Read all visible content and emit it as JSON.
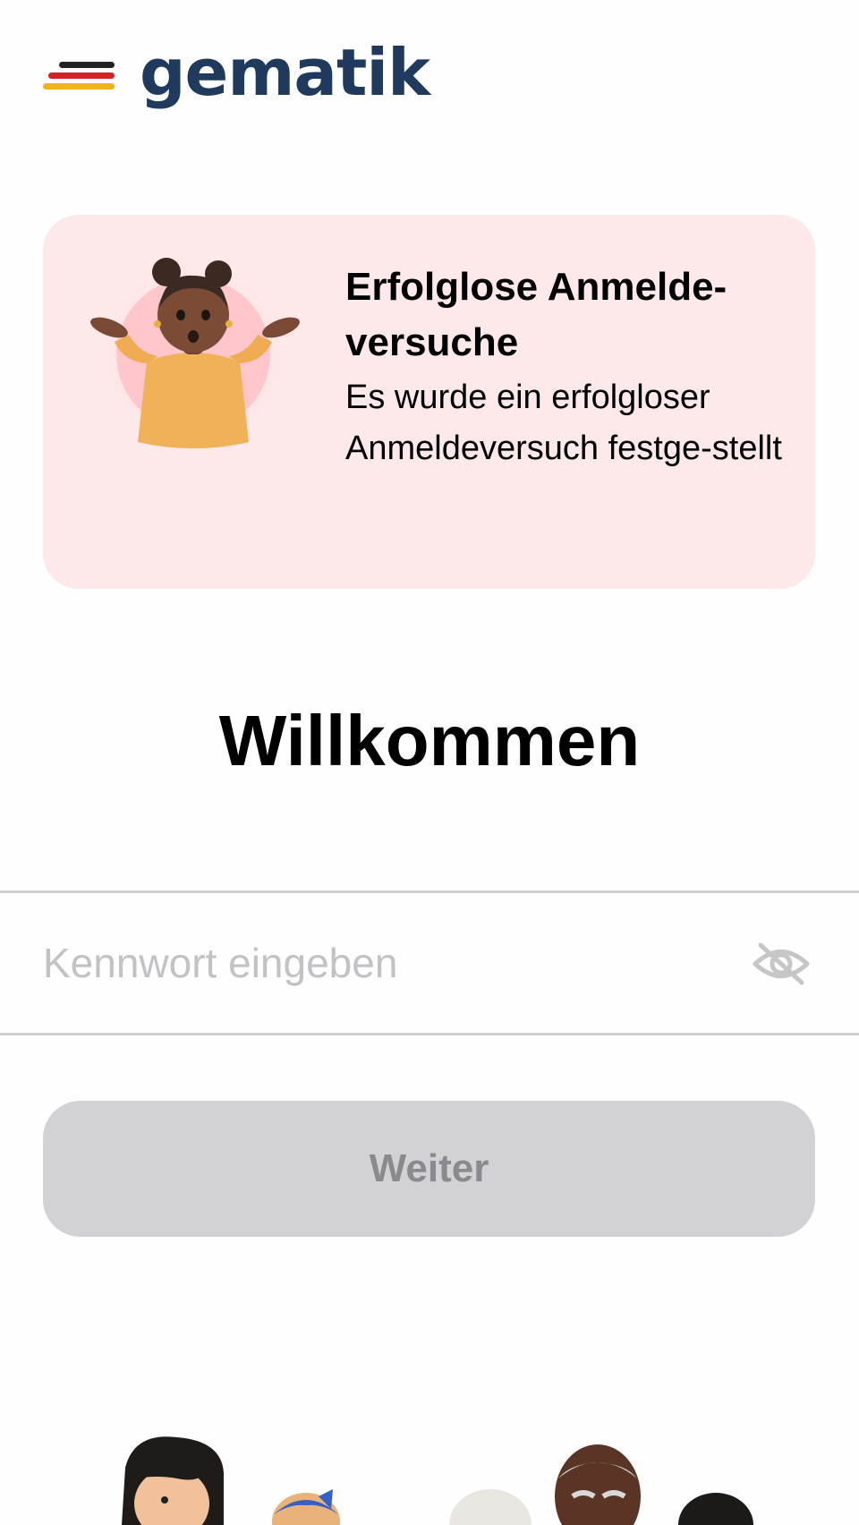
{
  "brand": {
    "name": "gematik",
    "flag_colors": [
      "#222222",
      "#d61f26",
      "#f2b318"
    ],
    "text_color": "#1f3a5d"
  },
  "alert": {
    "title": "Erfolglose Anmelde-versuche",
    "message": "Es wurde ein erfolgloser Anmeldeversuch festge-stellt",
    "background": "#fde8ea",
    "illustration": "shrugging-person"
  },
  "welcome": {
    "title": "Willkommen"
  },
  "password": {
    "value": "",
    "placeholder": "Kennwort eingeben",
    "visibility_icon": "eye-slash-icon"
  },
  "actions": {
    "next_label": "Weiter",
    "next_enabled": false
  },
  "footer": {
    "illustration": "group-of-people"
  }
}
